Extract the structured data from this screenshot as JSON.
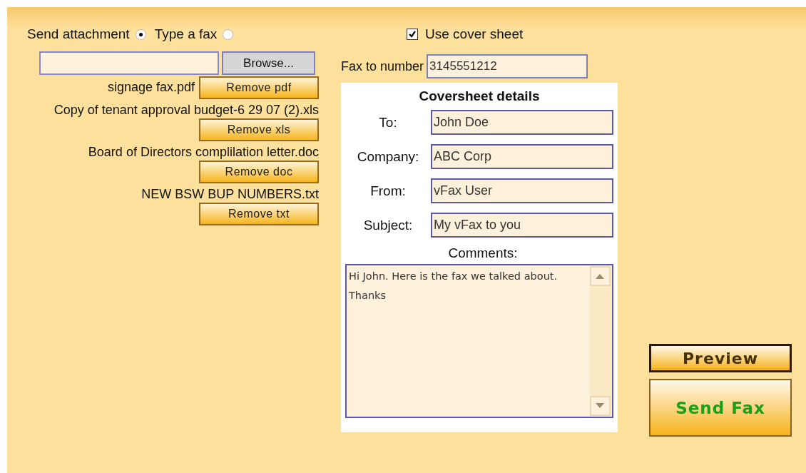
{
  "mode_options": [
    {
      "label": "Send attachment",
      "selected": true
    },
    {
      "label": "Type a fax",
      "selected": false
    }
  ],
  "cover_sheet": {
    "label": "Use cover sheet",
    "checked": true
  },
  "file_picker": {
    "button": "Browse..."
  },
  "attachments": [
    {
      "name": "signage fax.pdf",
      "button": "Remove pdf"
    },
    {
      "name": "Copy of tenant approval budget-6 29 07 (2).xls",
      "button": "Remove xls"
    },
    {
      "name": "Board of Directors complilation letter.doc",
      "button": "Remove doc"
    },
    {
      "name": "NEW BSW BUP NUMBERS.txt",
      "button": "Remove txt"
    }
  ],
  "fax_number": {
    "label": "Fax to number",
    "value": "3145551212"
  },
  "coversheet": {
    "title": "Coversheet details",
    "fields": [
      {
        "label": "To:",
        "value": "John Doe"
      },
      {
        "label": "Company:",
        "value": "ABC Corp"
      },
      {
        "label": "From:",
        "value": "vFax User"
      },
      {
        "label": "Subject:",
        "value": "My vFax to you"
      }
    ],
    "comments_label": "Comments:",
    "comments": "Hi John. Here is the fax we talked about. Thanks"
  },
  "actions": [
    {
      "kind": "preview",
      "label": "Preview"
    },
    {
      "kind": "send",
      "label": "Send Fax"
    }
  ]
}
